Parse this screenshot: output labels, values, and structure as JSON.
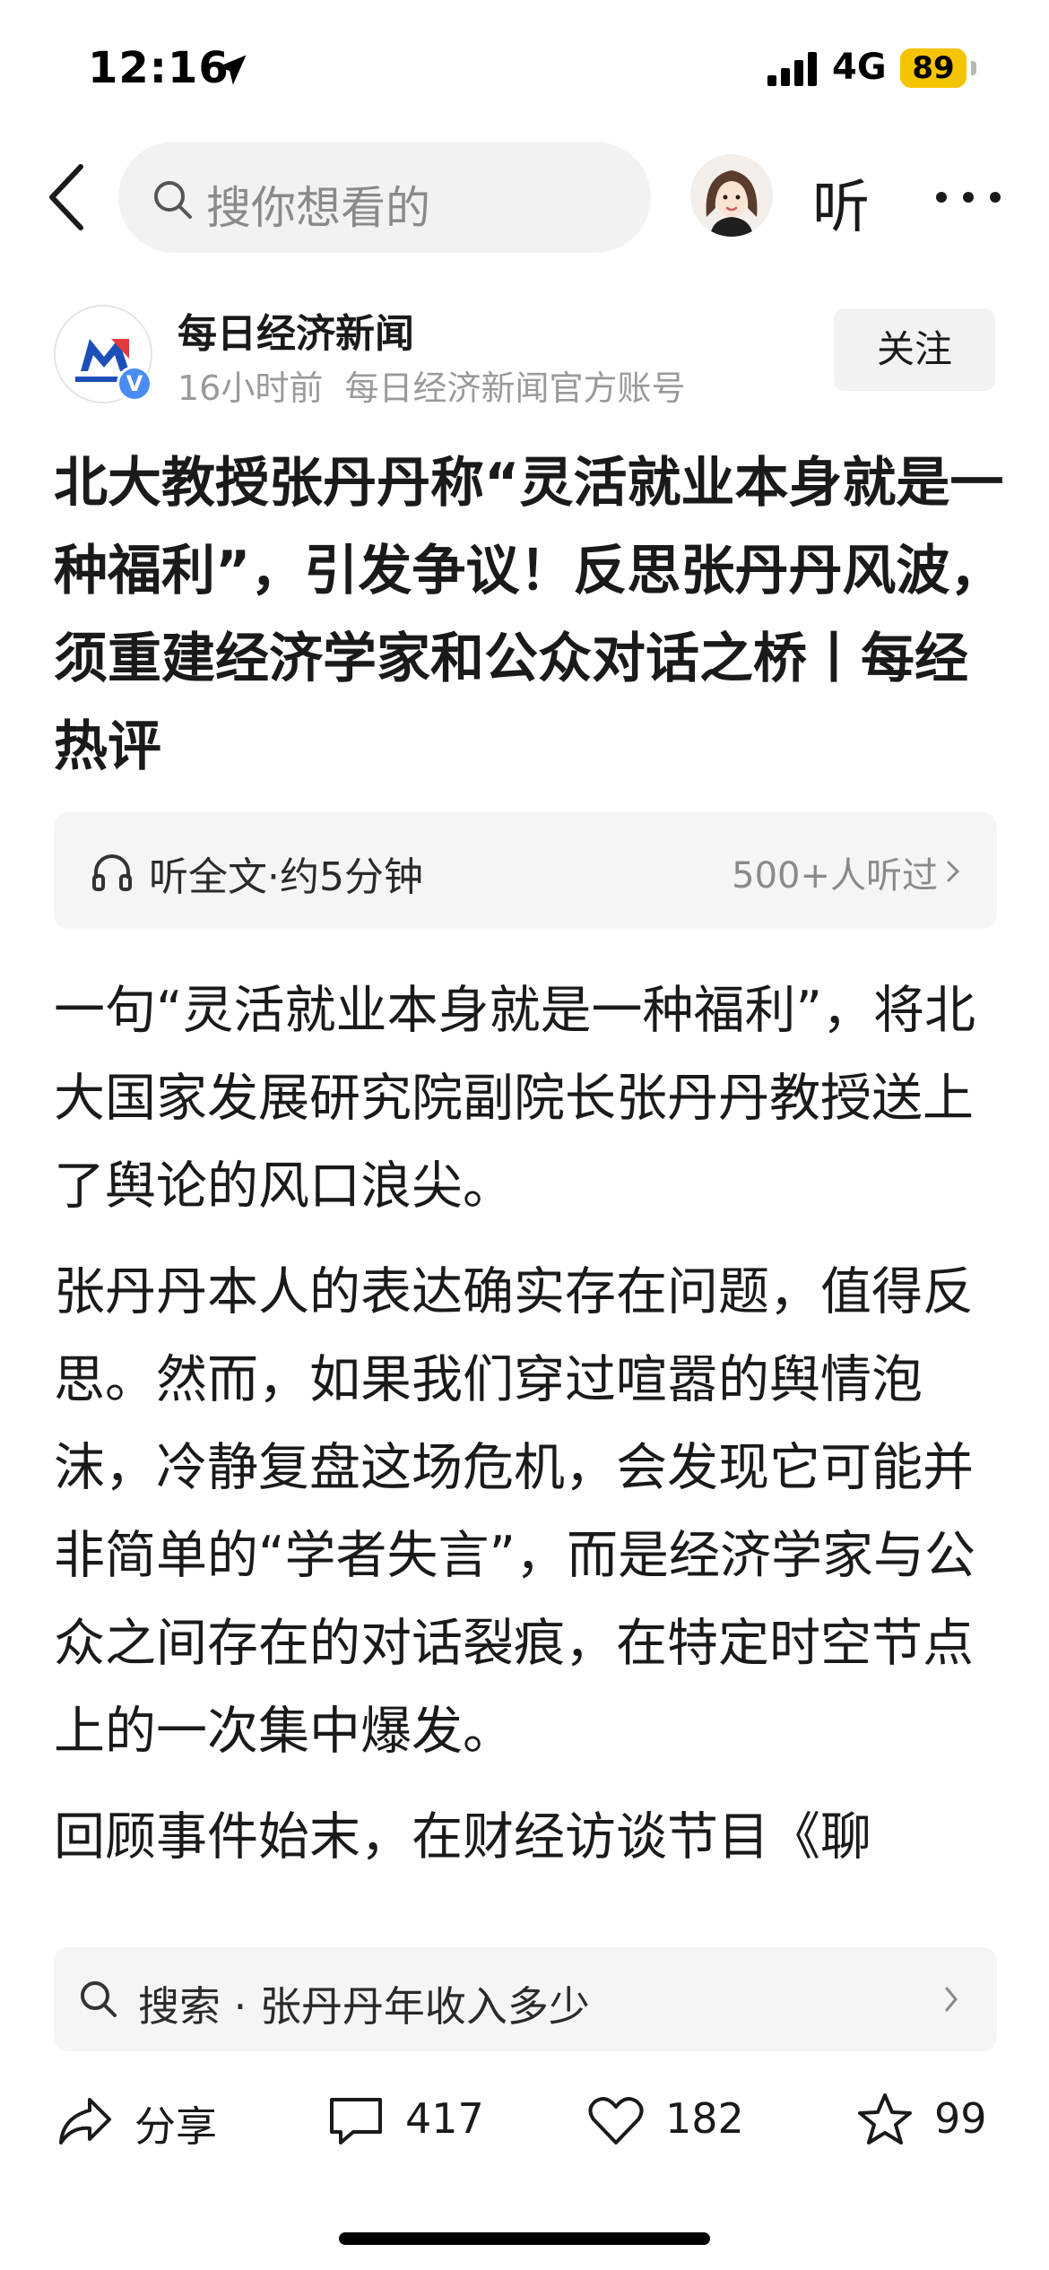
{
  "status_bar": {
    "time": "12:16",
    "network": "4G",
    "battery": "89",
    "battery_color": "#f5c400"
  },
  "nav": {
    "search_placeholder": "搜你想看的",
    "listen_label": "听",
    "icons": [
      "back-icon",
      "search-icon",
      "avatar",
      "more-icon"
    ]
  },
  "author": {
    "name": "每日经济新闻",
    "time": "16小时前",
    "desc": "每日经济新闻官方账号",
    "verified": "V",
    "follow_label": "关注"
  },
  "article": {
    "title": "北大教授张丹丹称“灵活就业本身就是一种福利”，引发争议！反思张丹丹风波，须重建经济学家和公众对话之桥丨每经热评",
    "listen_bar": {
      "label": "听全文·约5分钟",
      "count": "500+人听过"
    },
    "paragraphs": [
      "一句“灵活就业本身就是一种福利”，将北大国家发展研究院副院长张丹丹教授送上了舆论的风口浪尖。",
      "张丹丹本人的表达确实存在问题，值得反思。然而，如果我们穿过喧嚣的舆情泡沫，冷静复盘这场危机，会发现它可能并非简单的“学者失言”，而是经济学家与公众之间存在的对话裂痕，在特定时空节点上的一次集中爆发。",
      "回顾事件始末，在财经访谈节目《聊"
    ]
  },
  "suggestion": {
    "prefix": "搜索",
    "separator": "·",
    "query": "张丹丹年收入多少"
  },
  "actions": {
    "share_label": "分享",
    "comments": "417",
    "likes": "182",
    "favorites": "99"
  }
}
